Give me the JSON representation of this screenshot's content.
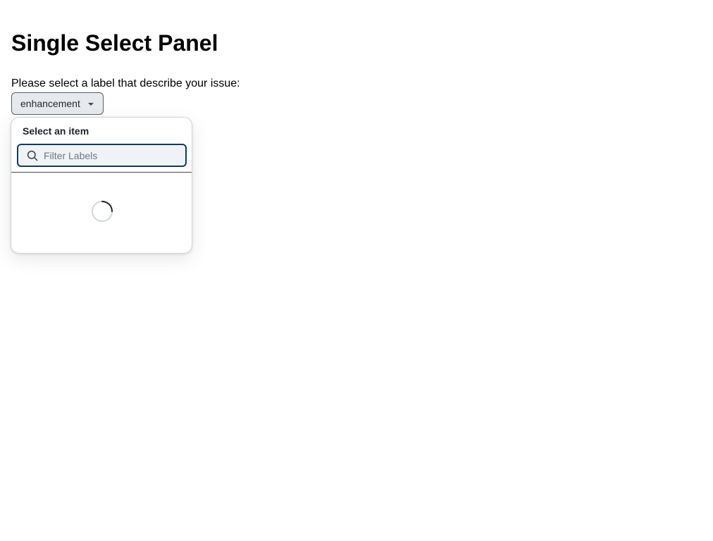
{
  "page": {
    "title": "Single Select Panel",
    "prompt": "Please select a label that describe your issue:"
  },
  "select_button": {
    "label": "enhancement",
    "icon": "triangle-down-icon"
  },
  "panel": {
    "title": "Select an item",
    "filter": {
      "value": "",
      "placeholder": "Filter Labels",
      "icon": "search-icon"
    },
    "loading": true
  },
  "colors": {
    "focus_border": "#0e3a6b",
    "button_bg": "#e6e9ed",
    "input_bg": "#f0f3f6"
  }
}
